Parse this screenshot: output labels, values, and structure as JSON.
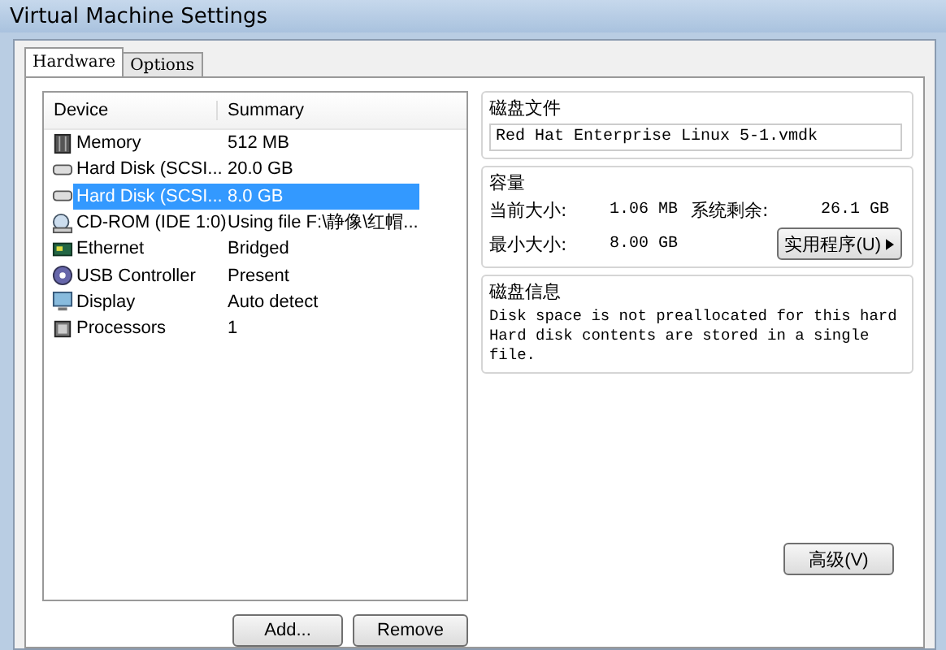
{
  "window": {
    "title": "Virtual Machine Settings"
  },
  "tabs": [
    {
      "label": "Hardware",
      "selected": true
    },
    {
      "label": "Options",
      "selected": false
    }
  ],
  "device_table": {
    "columns": [
      "Device",
      "Summary"
    ],
    "rows": [
      {
        "kind": "memory",
        "device": "Memory",
        "summary": "512 MB",
        "selected": false
      },
      {
        "kind": "disk",
        "device": "Hard Disk (SCSI...",
        "summary": "20.0 GB",
        "selected": false
      },
      {
        "kind": "disk",
        "device": "Hard Disk (SCSI...",
        "summary": "8.0 GB",
        "selected": true
      },
      {
        "kind": "cdrom",
        "device": "CD-ROM (IDE 1:0)",
        "summary": "Using file F:\\静像\\红帽...",
        "selected": false
      },
      {
        "kind": "network",
        "device": "Ethernet",
        "summary": "Bridged",
        "selected": false
      },
      {
        "kind": "usb",
        "device": "USB Controller",
        "summary": "Present",
        "selected": false
      },
      {
        "kind": "display",
        "device": "Display",
        "summary": "Auto detect",
        "selected": false
      },
      {
        "kind": "cpu",
        "device": "Processors",
        "summary": "1",
        "selected": false
      }
    ]
  },
  "list_buttons": [
    "Add...",
    "Remove"
  ],
  "disk_file": {
    "title": "磁盘文件",
    "value": "Red Hat Enterprise Linux 5-1.vmdk"
  },
  "capacity": {
    "title": "容量",
    "current_label": "当前大小:",
    "current_value": "1.06 MB",
    "free_label": "系统剩余:",
    "free_value": "26.1 GB",
    "max_label": "最小大小:",
    "max_value": "8.00 GB",
    "utilities_button": "实用程序(U)"
  },
  "disk_info": {
    "title": "磁盘信息",
    "lines": [
      "Disk space is not preallocated for this hard",
      "Hard disk contents are stored in a single",
      "file."
    ]
  },
  "advanced_button": "高级(V)"
}
